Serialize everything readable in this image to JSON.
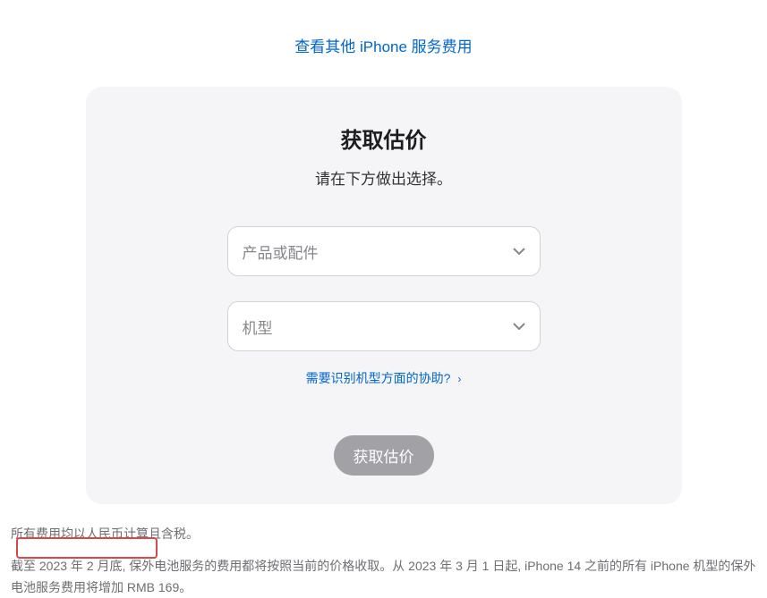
{
  "topLink": {
    "label": "查看其他 iPhone 服务费用"
  },
  "card": {
    "title": "获取估价",
    "subtitle": "请在下方做出选择。",
    "productSelect": {
      "placeholder": "产品或配件"
    },
    "modelSelect": {
      "placeholder": "机型"
    },
    "helpLink": {
      "label": "需要识别机型方面的协助?"
    },
    "submitButton": {
      "label": "获取估价"
    }
  },
  "footer": {
    "note1": "所有费用均以人民币计算且含税。",
    "note2": "截至 2023 年 2 月底, 保外电池服务的费用都将按照当前的价格收取。从 2023 年 3 月 1 日起, iPhone 14 之前的所有 iPhone 机型的保外电池服务费用将增加 RMB 169。"
  }
}
